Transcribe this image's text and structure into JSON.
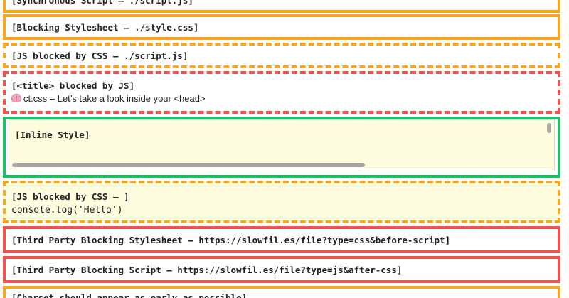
{
  "boxes": {
    "b0": {
      "label": "[Synchronous Script — ./script.js]"
    },
    "b1": {
      "label": "[Blocking Stylesheet — ./style.css]"
    },
    "b2": {
      "label": "[JS blocked by CSS — ./script.js]"
    },
    "b3": {
      "label": "[<title> blocked by JS]",
      "content": "ct.css – Let’s take a look inside your <head>",
      "icon": "brain-icon"
    },
    "b4": {
      "label": "[Inline Style]"
    },
    "b5": {
      "label": "[JS blocked by CSS — ]",
      "content": "console.log('Hello')"
    },
    "b6": {
      "label": "[Third Party Blocking Stylesheet — https://slowfil.es/file?type=css&before-script]"
    },
    "b7": {
      "label": "[Third Party Blocking Script — https://slowfil.es/file?type=js&after-css]"
    },
    "b8": {
      "label": "[Charset should appear as early as possible]"
    }
  },
  "colors": {
    "orange": "#f5a623",
    "red": "#ef5350",
    "green": "#22bb66",
    "yellow_bg": "#fffde0"
  }
}
